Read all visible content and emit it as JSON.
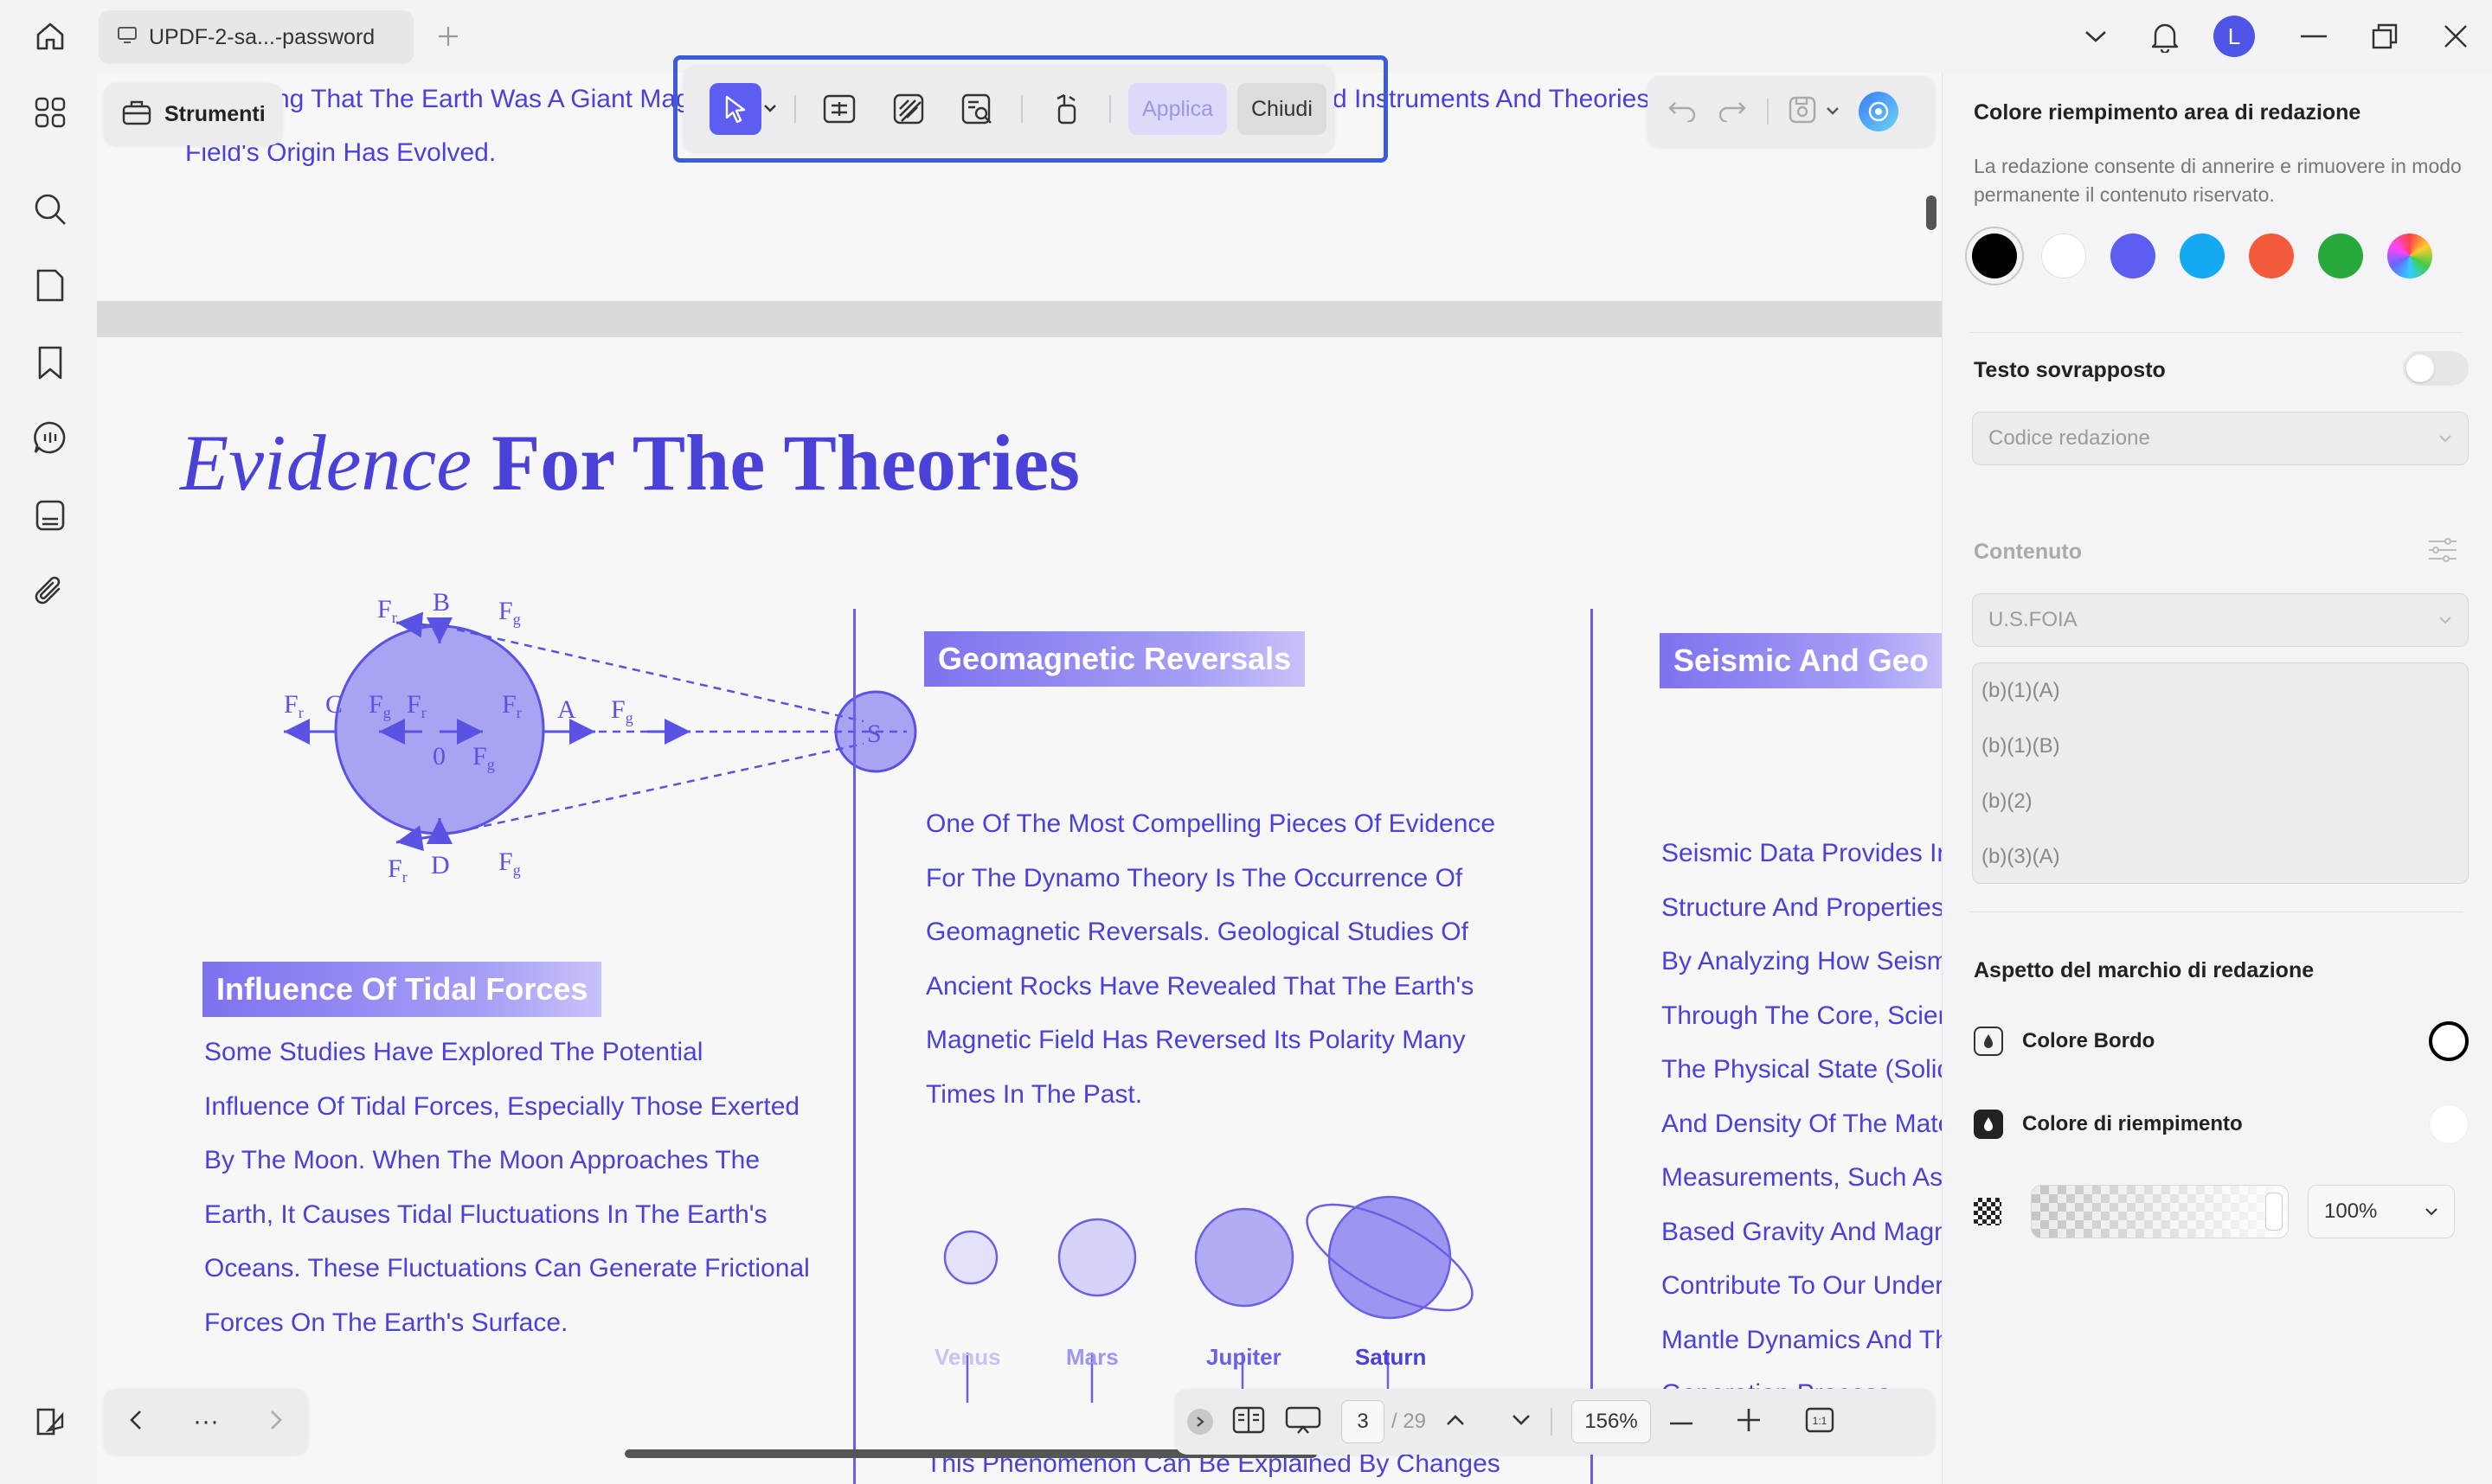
{
  "app": {
    "tab_title": "UPDF-2-sa...-password",
    "avatar_letter": "L"
  },
  "toolbar": {
    "tools_label": "Strumenti",
    "apply_label": "Applica",
    "close_label": "Chiudi"
  },
  "document": {
    "prev_page_text_line1_left": "ng That The Earth Was A Giant Magn",
    "prev_page_text_line1_right": "d Instruments And Theories,",
    "prev_page_text_line2": "Field's Origin Has Evolved.",
    "heading_italic": "Evidence",
    "heading_rest": "For The Theories",
    "col1": {
      "badge": "Influence Of Tidal Forces",
      "lines": [
        "Some Studies Have Explored The Potential",
        "Influence Of Tidal Forces, Especially Those Exerted",
        "By The Moon. When The Moon Approaches The",
        "Earth, It Causes Tidal Fluctuations In The Earth's",
        "Oceans. These Fluctuations Can Generate Frictional",
        "Forces On The Earth's Surface."
      ]
    },
    "col2": {
      "badge": "Geomagnetic Reversals",
      "lines": [
        "One Of The Most Compelling Pieces Of Evidence",
        "For The Dynamo Theory Is The Occurrence Of",
        "Geomagnetic Reversals. Geological Studies Of",
        "Ancient Rocks Have Revealed That The Earth's",
        "Magnetic Field Has Reversed Its Polarity Many",
        "Times In The Past."
      ],
      "planets": [
        "Venus",
        "Mars",
        "Jupiter",
        "Saturn"
      ],
      "cut_line": "This Phenomenon Can Be Explained By Changes"
    },
    "col3": {
      "badge": "Seismic And Geo",
      "lines": [
        "Seismic Data Provides In",
        "Structure And Properties",
        "By Analyzing How Seism",
        "Through The Core, Scier",
        "The Physical State (Solid",
        "And Density Of The Mate",
        "Measurements, Such As",
        "Based Gravity And Magn",
        "Contribute To Our Under",
        "Mantle Dynamics And Th",
        "Generation Process."
      ]
    },
    "diagram_labels": {
      "B": "B",
      "C": "C",
      "A": "A",
      "D": "D",
      "O": "0",
      "S": "S",
      "Fr": "F",
      "Fg": "F",
      "sub_r": "r",
      "sub_g": "g"
    }
  },
  "pagination": {
    "current_page": "3",
    "total_pages": "/ 29",
    "zoom": "156%"
  },
  "panel": {
    "fill_color_title": "Colore riempimento area di redazione",
    "fill_color_desc": "La redazione consente di annerire e rimuovere in modo permanente il contenuto riservato.",
    "swatches": [
      "#000000",
      "#ffffff",
      "#5b5ef0",
      "#14a9f0",
      "#f45b3c",
      "#27a93c",
      "rainbow"
    ],
    "overlay_text_title": "Testo sovrapposto",
    "redaction_code_placeholder": "Codice redazione",
    "content_title": "Contenuto",
    "content_dropdown": "U.S.FOIA",
    "content_list": [
      "(b)(1)(A)",
      "(b)(1)(B)",
      "(b)(2)",
      "(b)(3)(A)"
    ],
    "appearance_title": "Aspetto del marchio di redazione",
    "border_color_label": "Colore Bordo",
    "fill_label": "Colore di riempimento",
    "opacity_value": "100%"
  },
  "colors": {
    "accent": "#5b5ef0",
    "doc_text": "#4a42d8",
    "highlight_border": "#3a5bdc"
  }
}
